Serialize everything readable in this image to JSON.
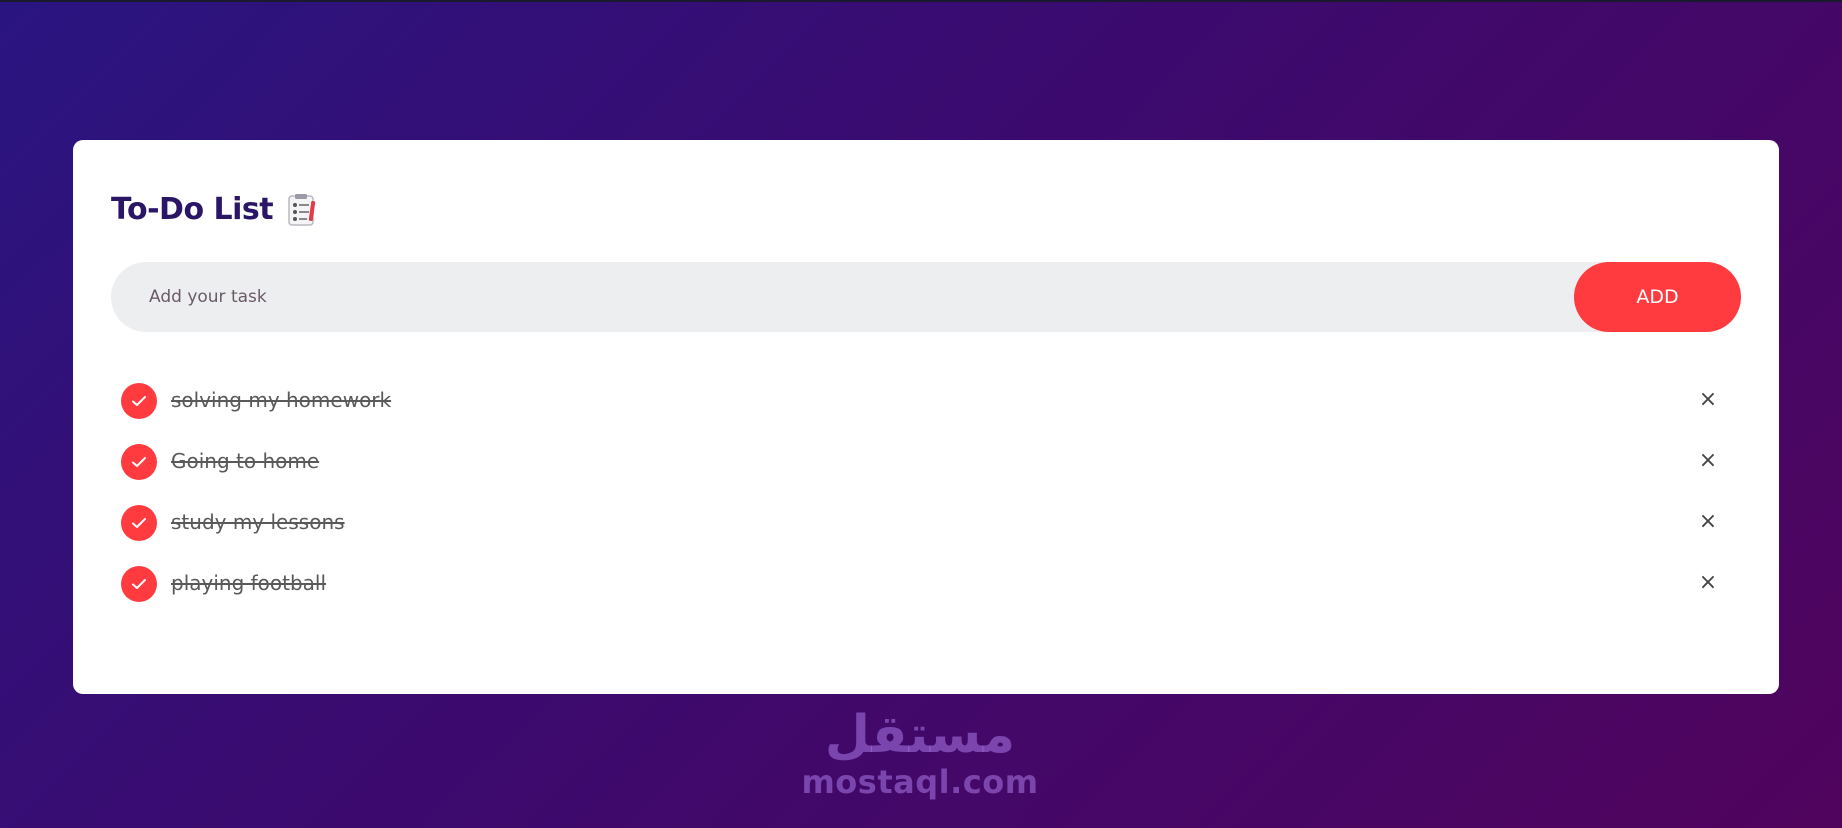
{
  "app": {
    "title": "To-Do List",
    "title_icon": "clipboard-checklist-icon"
  },
  "input": {
    "placeholder": "Add your task",
    "value": "",
    "add_label": "ADD"
  },
  "tasks": [
    {
      "text": "solving my homework",
      "completed": true
    },
    {
      "text": "Going to home",
      "completed": true
    },
    {
      "text": "study my lessons",
      "completed": true
    },
    {
      "text": "playing football",
      "completed": true
    }
  ],
  "delete_symbol": "×",
  "watermark": {
    "arabic": "مستقل",
    "latin": "mostaql.com"
  },
  "colors": {
    "accent": "#ff3b3f",
    "title": "#2b1566",
    "background_start": "#2a1580",
    "background_end": "#50045e"
  }
}
